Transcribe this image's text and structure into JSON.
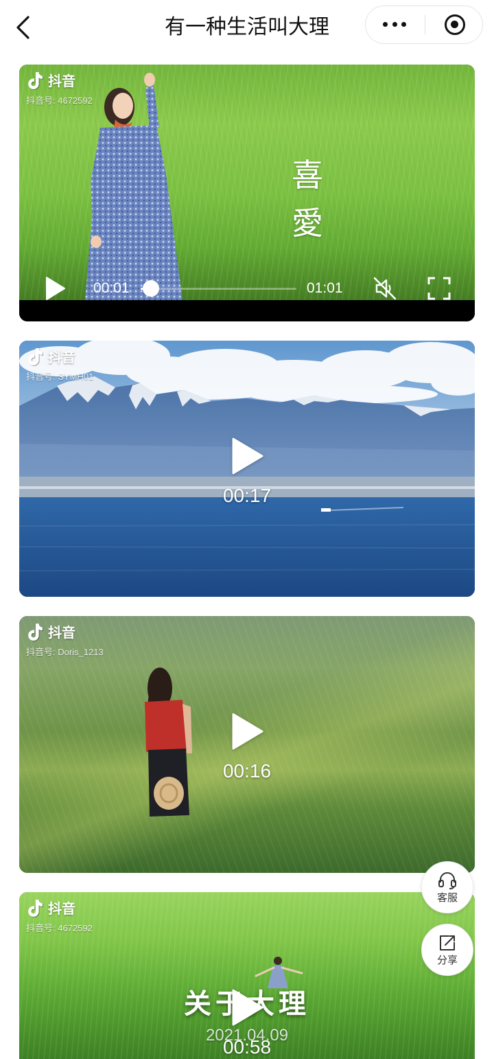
{
  "header": {
    "back_icon": "chevron-left-icon",
    "title": "有一种生活叫大理",
    "more_icon": "more-dots-icon",
    "close_icon": "target-circle-icon"
  },
  "videos": [
    {
      "platform_icon": "douyin-logo-icon",
      "platform": "抖音",
      "account": "抖音号: 4672592",
      "overlay_text": [
        "喜",
        "愛"
      ],
      "controls": {
        "play_icon": "play-icon",
        "elapsed": "00:01",
        "duration": "01:01",
        "progress": 0.016,
        "mute_icon": "muted-speaker-icon",
        "fullscreen_icon": "fullscreen-icon"
      }
    },
    {
      "platform_icon": "douyin-logo-icon",
      "platform": "抖音",
      "account": "抖音号: SYMH01",
      "play_icon": "play-icon",
      "duration": "00:17"
    },
    {
      "platform_icon": "douyin-logo-icon",
      "platform": "抖音",
      "account": "抖音号: Doris_1213",
      "play_icon": "play-icon",
      "duration": "00:16"
    },
    {
      "platform_icon": "douyin-logo-icon",
      "platform": "抖音",
      "account": "抖音号: 4672592",
      "overlay_title": "关于大理",
      "overlay_date": "2021.04.09",
      "play_icon": "play-icon",
      "duration": "00:58"
    }
  ],
  "floating_buttons": [
    {
      "icon": "headset-icon",
      "label": "客服"
    },
    {
      "icon": "share-icon",
      "label": "分享"
    }
  ],
  "colors": {
    "page_background": "#ffffff",
    "title_text": "#111111",
    "overlay_text": "#ffffff",
    "player_strip": "#000000",
    "floating_label": "#333333"
  }
}
